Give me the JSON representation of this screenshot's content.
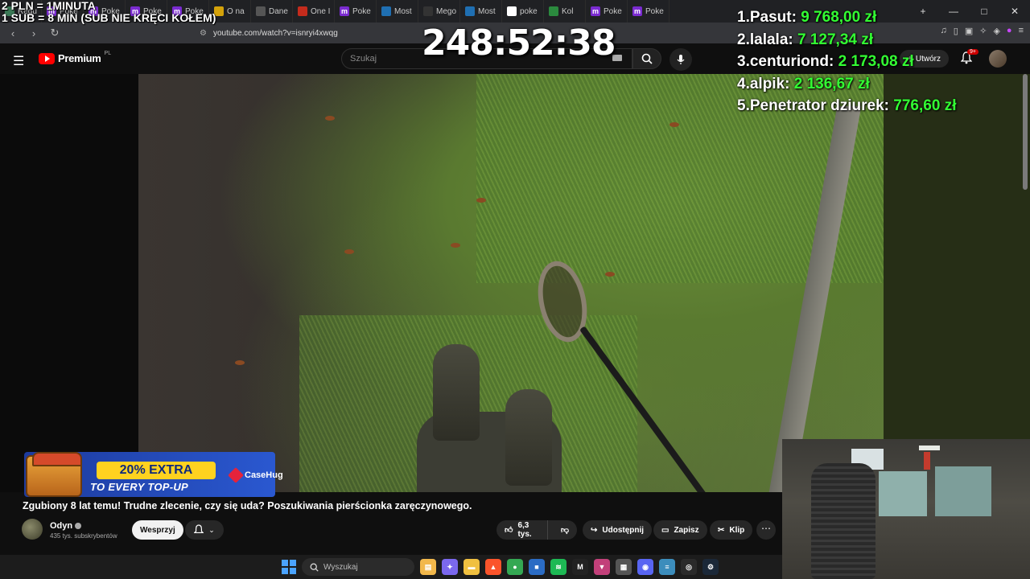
{
  "overlay": {
    "rules_line1": "2 PLN = 1MINUTA",
    "rules_line2": "1 SUB = 8 MIN (SUB NIE KRĘCI KOŁEM)",
    "timer": "248:52:38",
    "leaderboard": [
      {
        "rank": "1.",
        "name": "Pasut:",
        "amount": "9 768,00 zł"
      },
      {
        "rank": "2.",
        "name": "lalala:",
        "amount": "7 127,34 zł"
      },
      {
        "rank": "3.",
        "name": "centuriond:",
        "amount": "2 173,08 zł"
      },
      {
        "rank": "4.",
        "name": "alpik:",
        "amount": "2 136,67 zł"
      },
      {
        "rank": "5.",
        "name": "Penetrator dziurek:",
        "amount": "776,60 zł"
      }
    ],
    "name_color": "#ffffff",
    "amount_color": "#33ff33"
  },
  "browser": {
    "tabs": [
      {
        "label": "Regu",
        "icon": "globe-icon",
        "color": "#3b7a57"
      },
      {
        "label": "Poke",
        "icon": "m-icon",
        "color": "#7a2bd0"
      },
      {
        "label": "Poke",
        "icon": "m-icon",
        "color": "#7a2bd0"
      },
      {
        "label": "Poke",
        "icon": "m-icon",
        "color": "#7a2bd0"
      },
      {
        "label": "Poke",
        "icon": "m-icon",
        "color": "#7a2bd0"
      },
      {
        "label": "O na",
        "icon": "coin-icon",
        "color": "#d4a20a"
      },
      {
        "label": "Dane",
        "icon": "doc-icon",
        "color": "#555555"
      },
      {
        "label": "One I",
        "icon": "x-icon",
        "color": "#c42b1c"
      },
      {
        "label": "Poke",
        "icon": "m-icon",
        "color": "#7a2bd0"
      },
      {
        "label": "Most",
        "icon": "link-icon",
        "color": "#1f6fb2"
      },
      {
        "label": "Mego",
        "icon": "mp-icon",
        "color": "#333333"
      },
      {
        "label": "Most",
        "icon": "link-icon",
        "color": "#1f6fb2"
      },
      {
        "label": "poke",
        "icon": "google-icon",
        "color": "#ffffff"
      },
      {
        "label": "Kol",
        "icon": "pin-icon",
        "color": "#2b8a3e"
      },
      {
        "label": "Poke",
        "icon": "m-icon",
        "color": "#7a2bd0"
      },
      {
        "label": "Poke",
        "icon": "m-icon",
        "color": "#7a2bd0"
      }
    ],
    "url": "youtube.com/watch?v=isnryi4xwqg"
  },
  "youtube": {
    "brand": "Premium",
    "region": "PL",
    "search_placeholder": "Szukaj",
    "create_label": "Utwórz",
    "notifications_badge": "9+",
    "video_title": "Zgubiony 8 lat temu! Trudne zlecenie, czy się uda? Poszukiwania pierścionka zaręczynowego.",
    "channel_name": "Odyn",
    "subscribers": "435 tys. subskrybentów",
    "support_label": "Wesprzyj",
    "likes": "6,3 tys.",
    "share_label": "Udostępnij",
    "save_label": "Zapisz",
    "clip_label": "Klip",
    "more_label": "⋯"
  },
  "ad": {
    "badge": "20% EXTRA",
    "subline": "TO EVERY TOP-UP",
    "brand": "CaseHug"
  },
  "taskbar": {
    "search_placeholder": "Wyszukaj",
    "apps": [
      {
        "name": "file-explorer-icon",
        "color": "#f2b84b",
        "glyph": "▤"
      },
      {
        "name": "copilot-icon",
        "color": "#7b68ee",
        "glyph": "✦"
      },
      {
        "name": "folder-icon",
        "color": "#f0c040",
        "glyph": "▬"
      },
      {
        "name": "brave-icon",
        "color": "#fb542b",
        "glyph": "▲"
      },
      {
        "name": "chrome-icon",
        "color": "#34a853",
        "glyph": "●"
      },
      {
        "name": "store-icon",
        "color": "#2b6cc4",
        "glyph": "■"
      },
      {
        "name": "spotify-icon",
        "color": "#1db954",
        "glyph": "≋"
      },
      {
        "name": "mega-icon",
        "color": "#222222",
        "glyph": "M"
      },
      {
        "name": "browser-active-icon",
        "color": "#c2407a",
        "glyph": "▼"
      },
      {
        "name": "calculator-icon",
        "color": "#555555",
        "glyph": "▦"
      },
      {
        "name": "discord-icon",
        "color": "#5865f2",
        "glyph": "◉"
      },
      {
        "name": "notepad-icon",
        "color": "#3c8dbc",
        "glyph": "≡"
      },
      {
        "name": "obs-icon",
        "color": "#2a2a2a",
        "glyph": "◎"
      },
      {
        "name": "steam-icon",
        "color": "#1b2838",
        "glyph": "⚙"
      }
    ]
  }
}
